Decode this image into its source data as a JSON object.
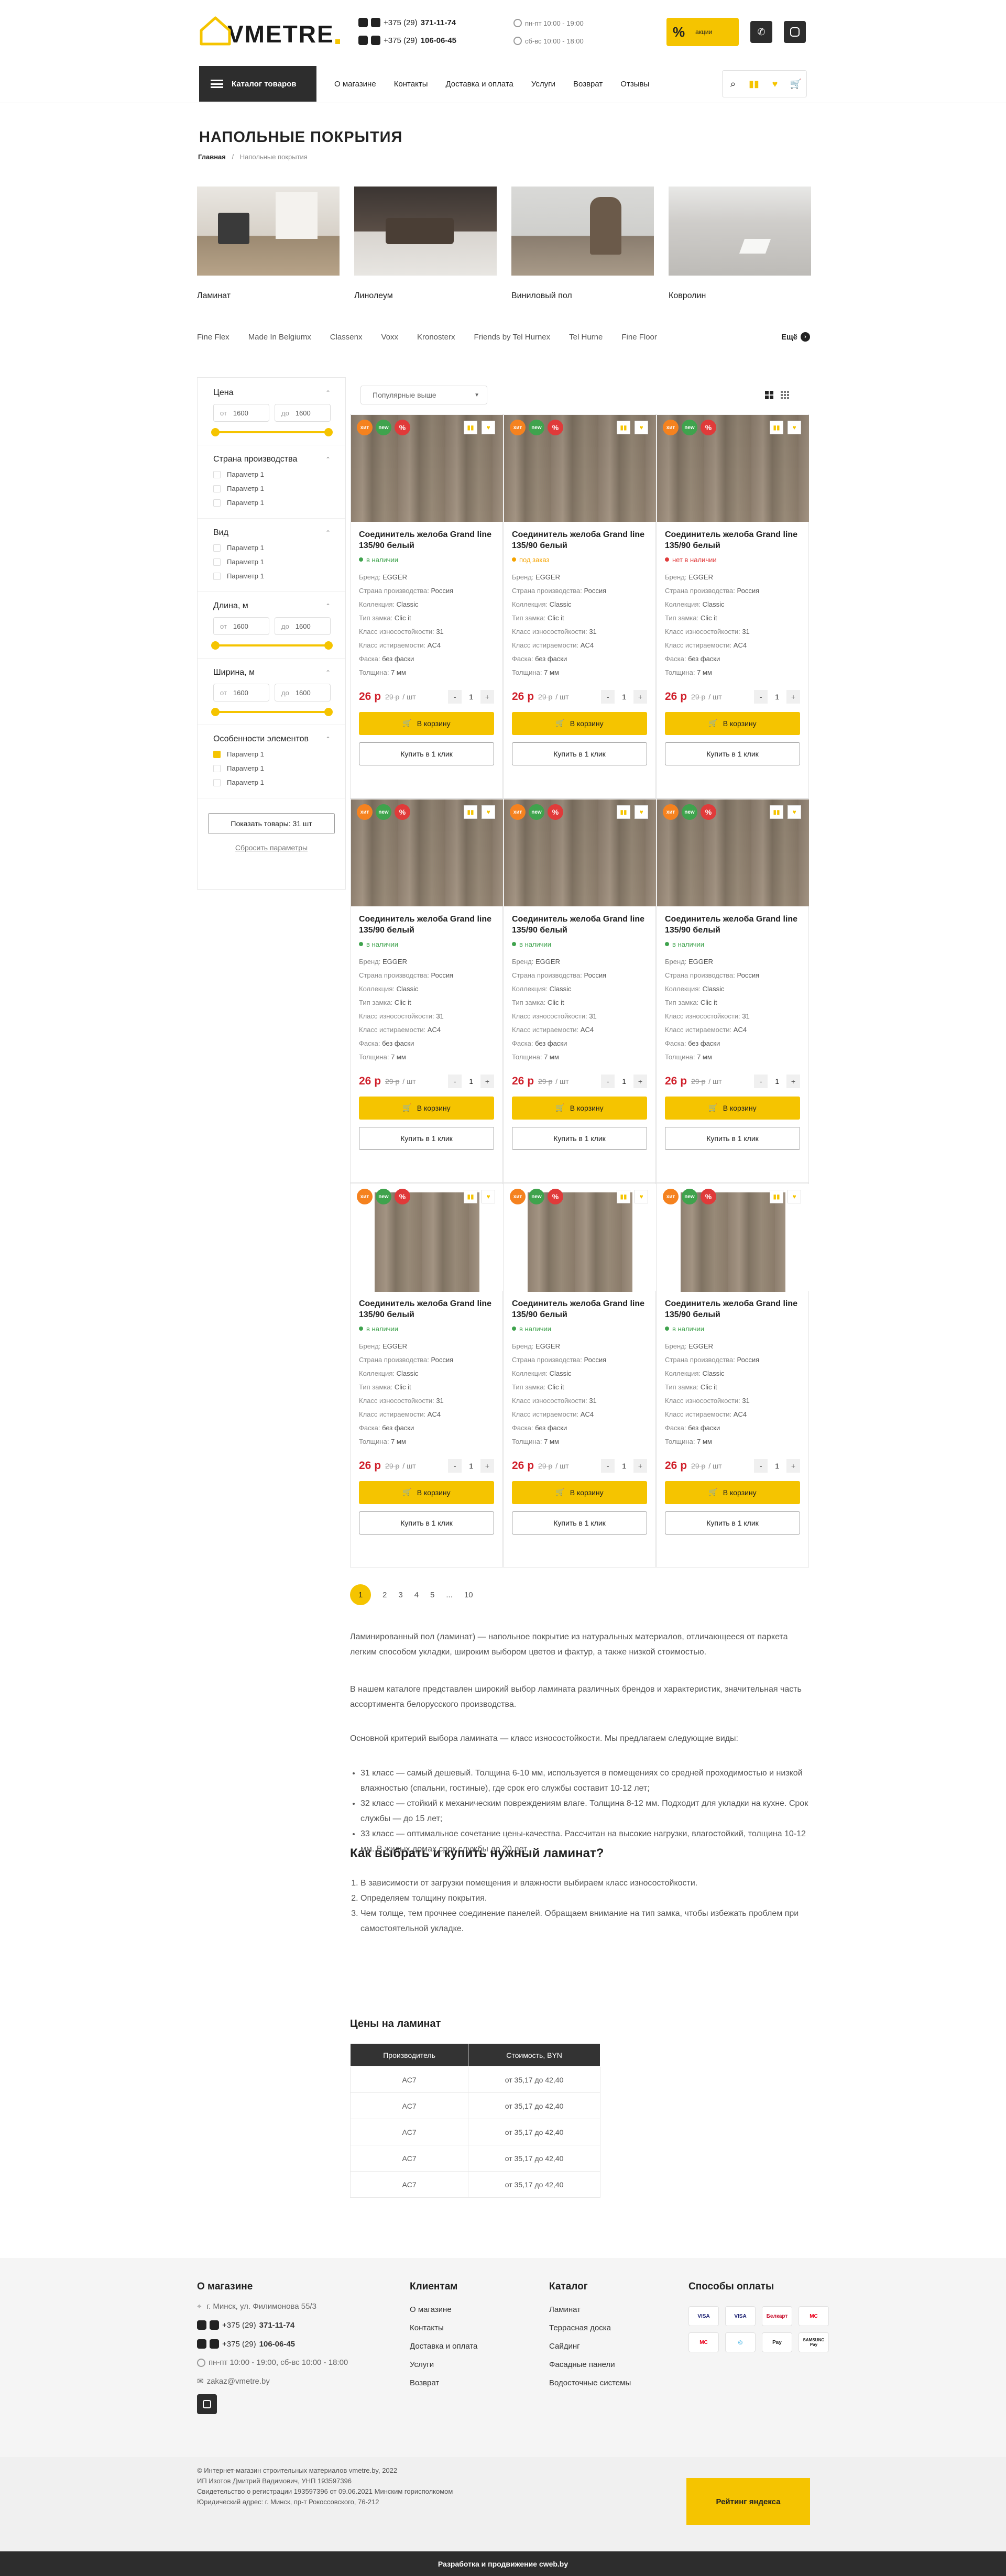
{
  "header": {
    "logo_text": "VMETRE",
    "phone1_prefix": "+375 (29)",
    "phone1_number": "371-11-74",
    "phone2_prefix": "+375 (29)",
    "phone2_number": "106-06-45",
    "hours1": "пн-пт 10:00 - 19:00",
    "hours2": "сб-вс 10:00 - 18:00",
    "promo_label": "акции",
    "catalog_button": "Каталог товаров",
    "nav": [
      "О магазине",
      "Контакты",
      "Доставка и оплата",
      "Услуги",
      "Возврат",
      "Отзывы"
    ]
  },
  "page": {
    "title": "НАПОЛЬНЫЕ ПОКРЫТИЯ",
    "breadcrumb_home": "Главная",
    "breadcrumb_sep": "/",
    "breadcrumb_current": "Напольные покрытия"
  },
  "categories": [
    "Ламинат",
    "Линолеум",
    "Виниловый пол",
    "Ковролин"
  ],
  "brands": [
    "Fine Flex",
    "Made In Belgiumх",
    "Classenх",
    "Voxх",
    "Kronosterх",
    "Friends by Tel Hurnex",
    "Tel Hurne",
    "Fine Floor"
  ],
  "brands_more": "Ещё",
  "filters": {
    "price_title": "Цена",
    "from": "от",
    "to": "до",
    "from_value": "1600",
    "to_value": "1600",
    "country_title": "Страна производства",
    "type_title": "Вид",
    "length_title": "Длина, м",
    "width_title": "Ширина, м",
    "features_title": "Особенности элементов",
    "param": "Параметр 1",
    "show_button": "Показать товары: 31 шт",
    "reset": "Сбросить параметры"
  },
  "sort": {
    "label": "Популярные выше"
  },
  "product": {
    "badge_hit": "хит",
    "badge_new": "new",
    "badge_sale": "%",
    "name": "Соединитель желоба Grand line 135/90 белый",
    "in_stock": "в наличии",
    "on_order": "под заказ",
    "not_in_stock": "нет в наличии",
    "brand_label": "Бренд:",
    "brand": "EGGER",
    "country_label": "Страна производства:",
    "country": "Россия",
    "collection_label": "Коллекция:",
    "collection": "Classic",
    "lock_label": "Тип замка:",
    "lock": "Clic it",
    "wear_label": "Класс износостойкости:",
    "wear": "31",
    "abrasion_label": "Класс истираемости:",
    "abrasion": "AC4",
    "chamfer_label": "Фаска:",
    "chamfer": "без фаски",
    "thickness_label": "Толщина:",
    "thickness": "7 мм",
    "price": "26 р",
    "old_price": "29 р",
    "unit": "/ шт",
    "qty_minus": "-",
    "qty": "1",
    "qty_plus": "+",
    "cart_button": "В корзину",
    "oneclick_button": "Купить в 1 клик"
  },
  "pagination": {
    "current": "1",
    "pages": [
      "2",
      "3",
      "4",
      "5"
    ],
    "dots": "...",
    "last": "10"
  },
  "seo": {
    "p1": "Ламинированный пол (ламинат) — напольное покрытие из натуральных материалов, отличающееся от паркета легким способом укладки, широким выбором цветов и фактур, а также низкой стоимостью.",
    "p2": "В нашем каталоге представлен широкий выбор ламината различных брендов и характеристик, значительная часть ассортимента белорусского производства.",
    "p3": "Основной критерий выбора ламината — класс износостойкости. Мы предлагаем следующие виды:",
    "bullets": [
      "31 класс — самый дешевый. Толщина 6-10 мм, используется в помещениях со средней проходимостью и низкой влажностью (спальни, гостиные), где срок его службы составит 10-12 лет;",
      "32 класс — стойкий к механическим повреждениям влаге. Толщина 8-12 мм. Подходит для укладки на кухне. Срок службы — до 15 лет;",
      "33 класс — оптимальное сочетание цены-качества. Рассчитан на высокие нагрузки, влагостойкий, толщина 10-12 мм. В жилых домах срок службы до 20 лет."
    ],
    "h2": "Как выбрать и купить нужный ламинат?",
    "steps": [
      "В зависимости от загрузки помещения и влажности выбираем класс износостойкости.",
      "Определяем толщину покрытия.",
      "Чем толще, тем прочнее соединение панелей. Обращаем внимание на тип замка, чтобы избежать проблем при самостоятельной укладке."
    ],
    "prices_h": "Цены на ламинат",
    "table_head": [
      "Производитель",
      "Стоимость, BYN"
    ],
    "table_rows": [
      [
        "AC7",
        "от 35,17 до 42,40"
      ],
      [
        "AC7",
        "от 35,17 до 42,40"
      ],
      [
        "AC7",
        "от 35,17 до 42,40"
      ],
      [
        "AC7",
        "от 35,17 до 42,40"
      ],
      [
        "AC7",
        "от 35,17 до 42,40"
      ]
    ]
  },
  "footer": {
    "about_h": "О магазине",
    "address": "г. Минск, ул. Филимонова 55/3",
    "phone1_prefix": "+375 (29)",
    "phone1_number": "371-11-74",
    "phone2_prefix": "+375 (29)",
    "phone2_number": "106-06-45",
    "hours": "пн-пт 10:00 - 19:00, сб-вс 10:00 - 18:00",
    "email": "zakaz@vmetre.by",
    "clients_h": "Клиентам",
    "clients": [
      "О магазине",
      "Контакты",
      "Доставка и оплата",
      "Услуги",
      "Возврат"
    ],
    "catalog_h": "Каталог",
    "catalog": [
      "Ламинат",
      "Террасная доска",
      "Сайдинг",
      "Фасадные панели",
      "Водосточные системы"
    ],
    "pay_h": "Способы оплаты",
    "pay": [
      "VISA",
      "VISA",
      "Белкарт",
      "MC",
      "MC",
      "◎",
      "Pay",
      "SAMSUNG Pay"
    ],
    "legal": [
      "© Интернет-магазин строительных материалов vmetre.by, 2022",
      "ИП Изотов Дмитрий Вадимович, УНП 193597396",
      "Свидетельство о регистрации 193597396 от 09.06.2021 Минским горисполкомом",
      "Юридический адрес: г. Минск, пр-т Рокоссовского, 76-212"
    ],
    "yandex": "Рейтинг яндекса",
    "dev": "Разработка и продвижение cweb.by"
  },
  "colors": {
    "accent": "#f5c400",
    "dark": "#2d2d2d",
    "price": "#d0202b",
    "hit": "#f5821f",
    "new": "#3fa34d",
    "sale": "#e03a3a"
  }
}
